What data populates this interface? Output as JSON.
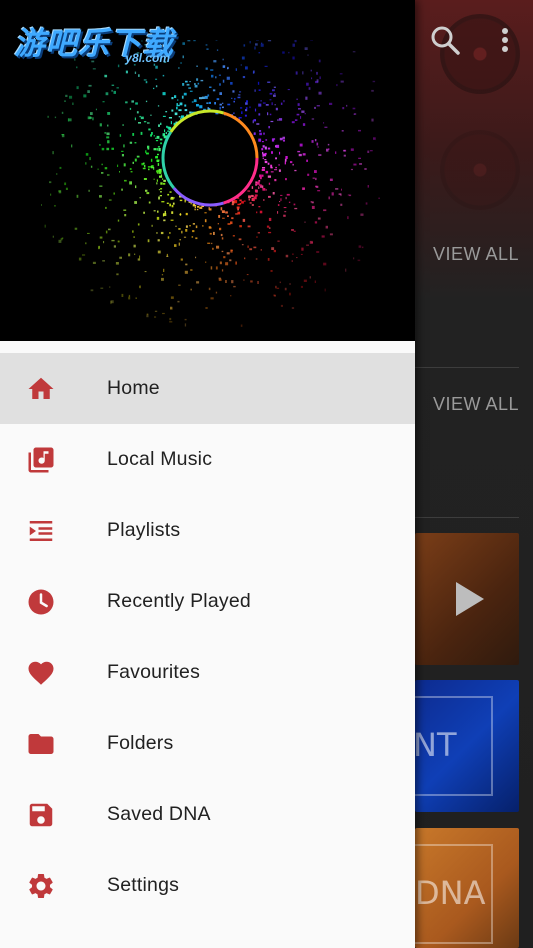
{
  "colors": {
    "accent": "#c0393b",
    "drawer_bg": "#fafafa",
    "active_bg": "#e0e0e0",
    "text": "#212121"
  },
  "header": {
    "logo_text": "游吧乐下载",
    "logo_sub": "y8l.com"
  },
  "background": {
    "view_all_1": "VIEW ALL",
    "view_all_2": "VIEW ALL",
    "card2_text": "NT",
    "card3_text": "DNA"
  },
  "menu": [
    {
      "label": "Home",
      "icon": "home-icon",
      "active": true
    },
    {
      "label": "Local Music",
      "icon": "library-music-icon",
      "active": false
    },
    {
      "label": "Playlists",
      "icon": "playlist-icon",
      "active": false
    },
    {
      "label": "Recently Played",
      "icon": "clock-icon",
      "active": false
    },
    {
      "label": "Favourites",
      "icon": "heart-icon",
      "active": false
    },
    {
      "label": "Folders",
      "icon": "folder-icon",
      "active": false
    },
    {
      "label": "Saved DNA",
      "icon": "save-icon",
      "active": false
    },
    {
      "label": "Settings",
      "icon": "gear-icon",
      "active": false
    }
  ]
}
